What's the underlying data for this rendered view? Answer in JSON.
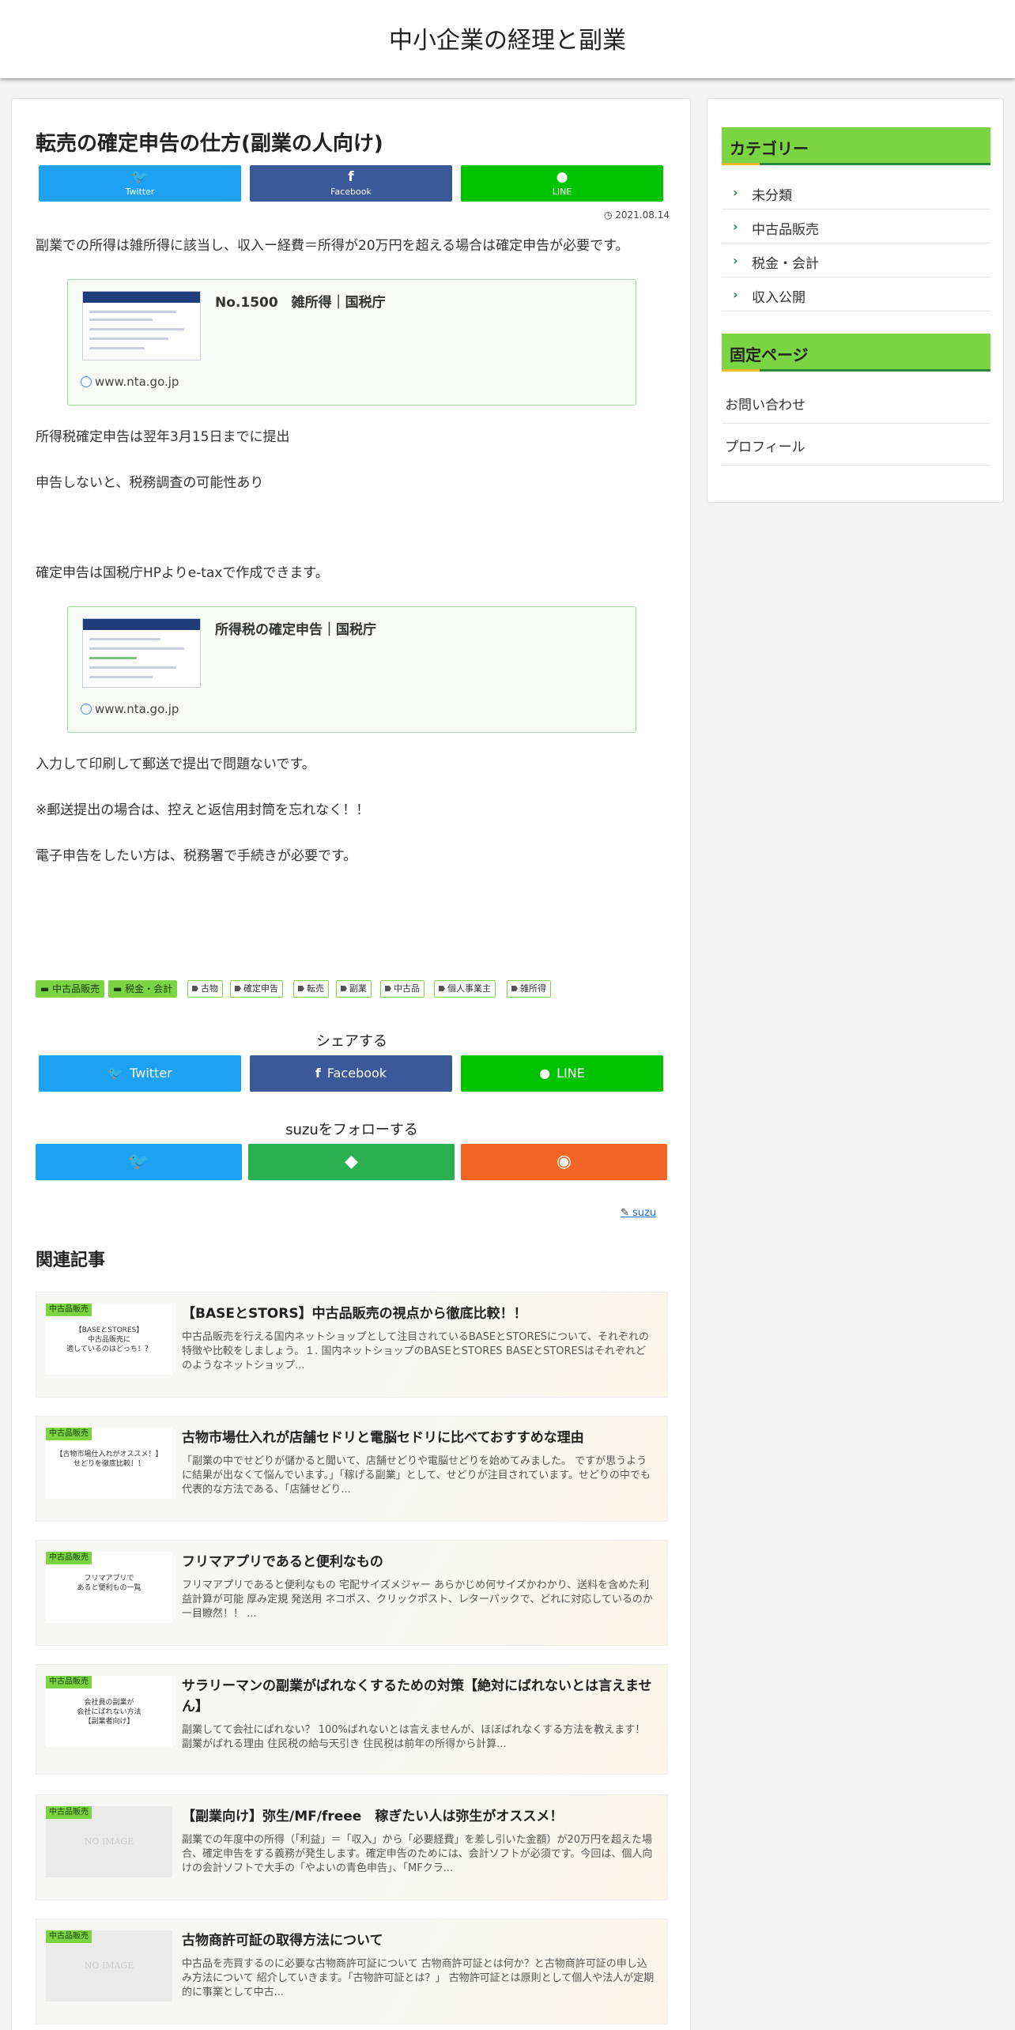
{
  "site": {
    "title": "中小企業の経理と副業"
  },
  "article": {
    "title": "転売の確定申告の仕方(副業の人向け)",
    "date": "2021.08.14",
    "share_top": [
      {
        "icon": "twitter-icon",
        "label": "Twitter"
      },
      {
        "icon": "facebook-icon",
        "label": "Facebook"
      },
      {
        "icon": "line-icon",
        "label": "LINE"
      }
    ],
    "p1": "副業での所得は雑所得に該当し、収入ー経費＝所得が20万円を超える場合は確定申告が必要です。",
    "card1": {
      "title": "No.1500　雑所得｜国税庁",
      "site": "www.nta.go.jp"
    },
    "p2": "所得税確定申告は翌年3月15日までに提出",
    "p3": "申告しないと、税務調査の可能性あり",
    "p4": "確定申告は国税庁HPよりe-taxで作成できます。",
    "card2": {
      "title": "所得税の確定申告｜国税庁",
      "site": "www.nta.go.jp"
    },
    "p5": "入力して印刷して郵送で提出で問題ないです。",
    "p6": "※郵送提出の場合は、控えと返信用封筒を忘れなく！！",
    "p7": "電子申告をしたい方は、税務署で手続きが必要です。",
    "categories": [
      "中古品販売",
      "税金・会計"
    ],
    "tags": [
      "古物",
      "確定申告",
      "転売",
      "副業",
      "中古品",
      "個人事業主",
      "雑所得"
    ],
    "share_heading": "シェアする",
    "share_bottom": [
      {
        "icon": "twitter-icon",
        "label": "Twitter"
      },
      {
        "icon": "facebook-icon",
        "label": "Facebook"
      },
      {
        "icon": "line-icon",
        "label": "LINE"
      }
    ],
    "follow_heading": "suzuをフォローする",
    "author": "suzu"
  },
  "related": {
    "heading": "関連記事",
    "items": [
      {
        "cat": "中古品販売",
        "thumb_text": "【BASEとSTORES】\n中古品販売に\n適しているのはどっち！？",
        "title": "【BASEとSTORS】中古品販売の視点から徹底比較！！",
        "excerpt": "中古品販売を行える国内ネットショップとして注目されているBASEとSTORESについて、それぞれの特徴や比較をしましょう。１. 国内ネットショップのBASEとSTORES BASEとSTORESはそれぞれどのようなネットショップ..."
      },
      {
        "cat": "中古品販売",
        "thumb_text": "【古物市場仕入れがオススメ！】\nせどりを徹底比較！！",
        "title": "古物市場仕入れが店舗セドリと電脳セドリに比べておすすめな理由",
        "excerpt": "「副業の中でせどりが儲かると聞いて、店舗せどりや電脳せどりを始めてみました。 ですが思うように結果が出なくて悩んでいます。」「稼げる副業」として、せどりが注目されています。せどりの中でも代表的な方法である、「店舗せどり..."
      },
      {
        "cat": "中古品販売",
        "thumb_text": "フリマアプリで\nあると便利もの一覧",
        "title": "フリマアプリであると便利なもの",
        "excerpt": "フリマアプリであると便利なもの 宅配サイズメジャー あらかじめ何サイズかわかり、送料を含めた利益計算が可能 厚み定規 発送用 ネコポス、クリックポスト、レターパックで、どれに対応しているのか一目瞭然！！ ..."
      },
      {
        "cat": "中古品販売",
        "thumb_text": "会社員の副業が\n会社にばれない方法\n【副業者向け】",
        "title": "サラリーマンの副業がばれなくするための対策【絶対にばれないとは言えません】",
        "excerpt": "副業してて会社にばれない？ 100%ばれないとは言えませんが、ほぼばれなくする方法を教えます！ 副業がばれる理由 住民税の給与天引き 住民税は前年の所得から計算..."
      },
      {
        "cat": "中古品販売",
        "thumb_text": "",
        "noimage": "NO IMAGE",
        "title": "【副業向け】弥生/MF/freee　稼ぎたい人は弥生がオススメ！",
        "excerpt": "副業での年度中の所得（「利益」＝「収入」から「必要経費」を差し引いた金額）が20万円を超えた場合、確定申告をする義務が発生します。確定申告のためには、会計ソフトが必須です。今回は、個人向けの会計ソフトで大手の「やよいの青色申告」、「MFクラ..."
      },
      {
        "cat": "中古品販売",
        "thumb_text": "",
        "noimage": "NO IMAGE",
        "title": "古物商許可証の取得方法について",
        "excerpt": "中古品を売買するのに必要な古物商許可証について 古物商許可証とは何か？と古物商許可証の申し込み方法について 紹介していきます。「古物許可証とは？」 古物許可証とは原則として個人や法人が定期的に事業として中古..."
      }
    ]
  },
  "sidebar": {
    "category_heading": "カテゴリー",
    "categories": [
      "未分類",
      "中古品販売",
      "税金・会計",
      "収入公開"
    ],
    "fixed_heading": "固定ページ",
    "fixed_pages": [
      "お問い合わせ",
      "プロフィール"
    ]
  },
  "colors": {
    "accent": "#7bd441",
    "twitter": "#1da1f2",
    "facebook": "#3b5998",
    "line": "#00c300",
    "feedly": "#2ab050",
    "rss": "#f26522"
  }
}
